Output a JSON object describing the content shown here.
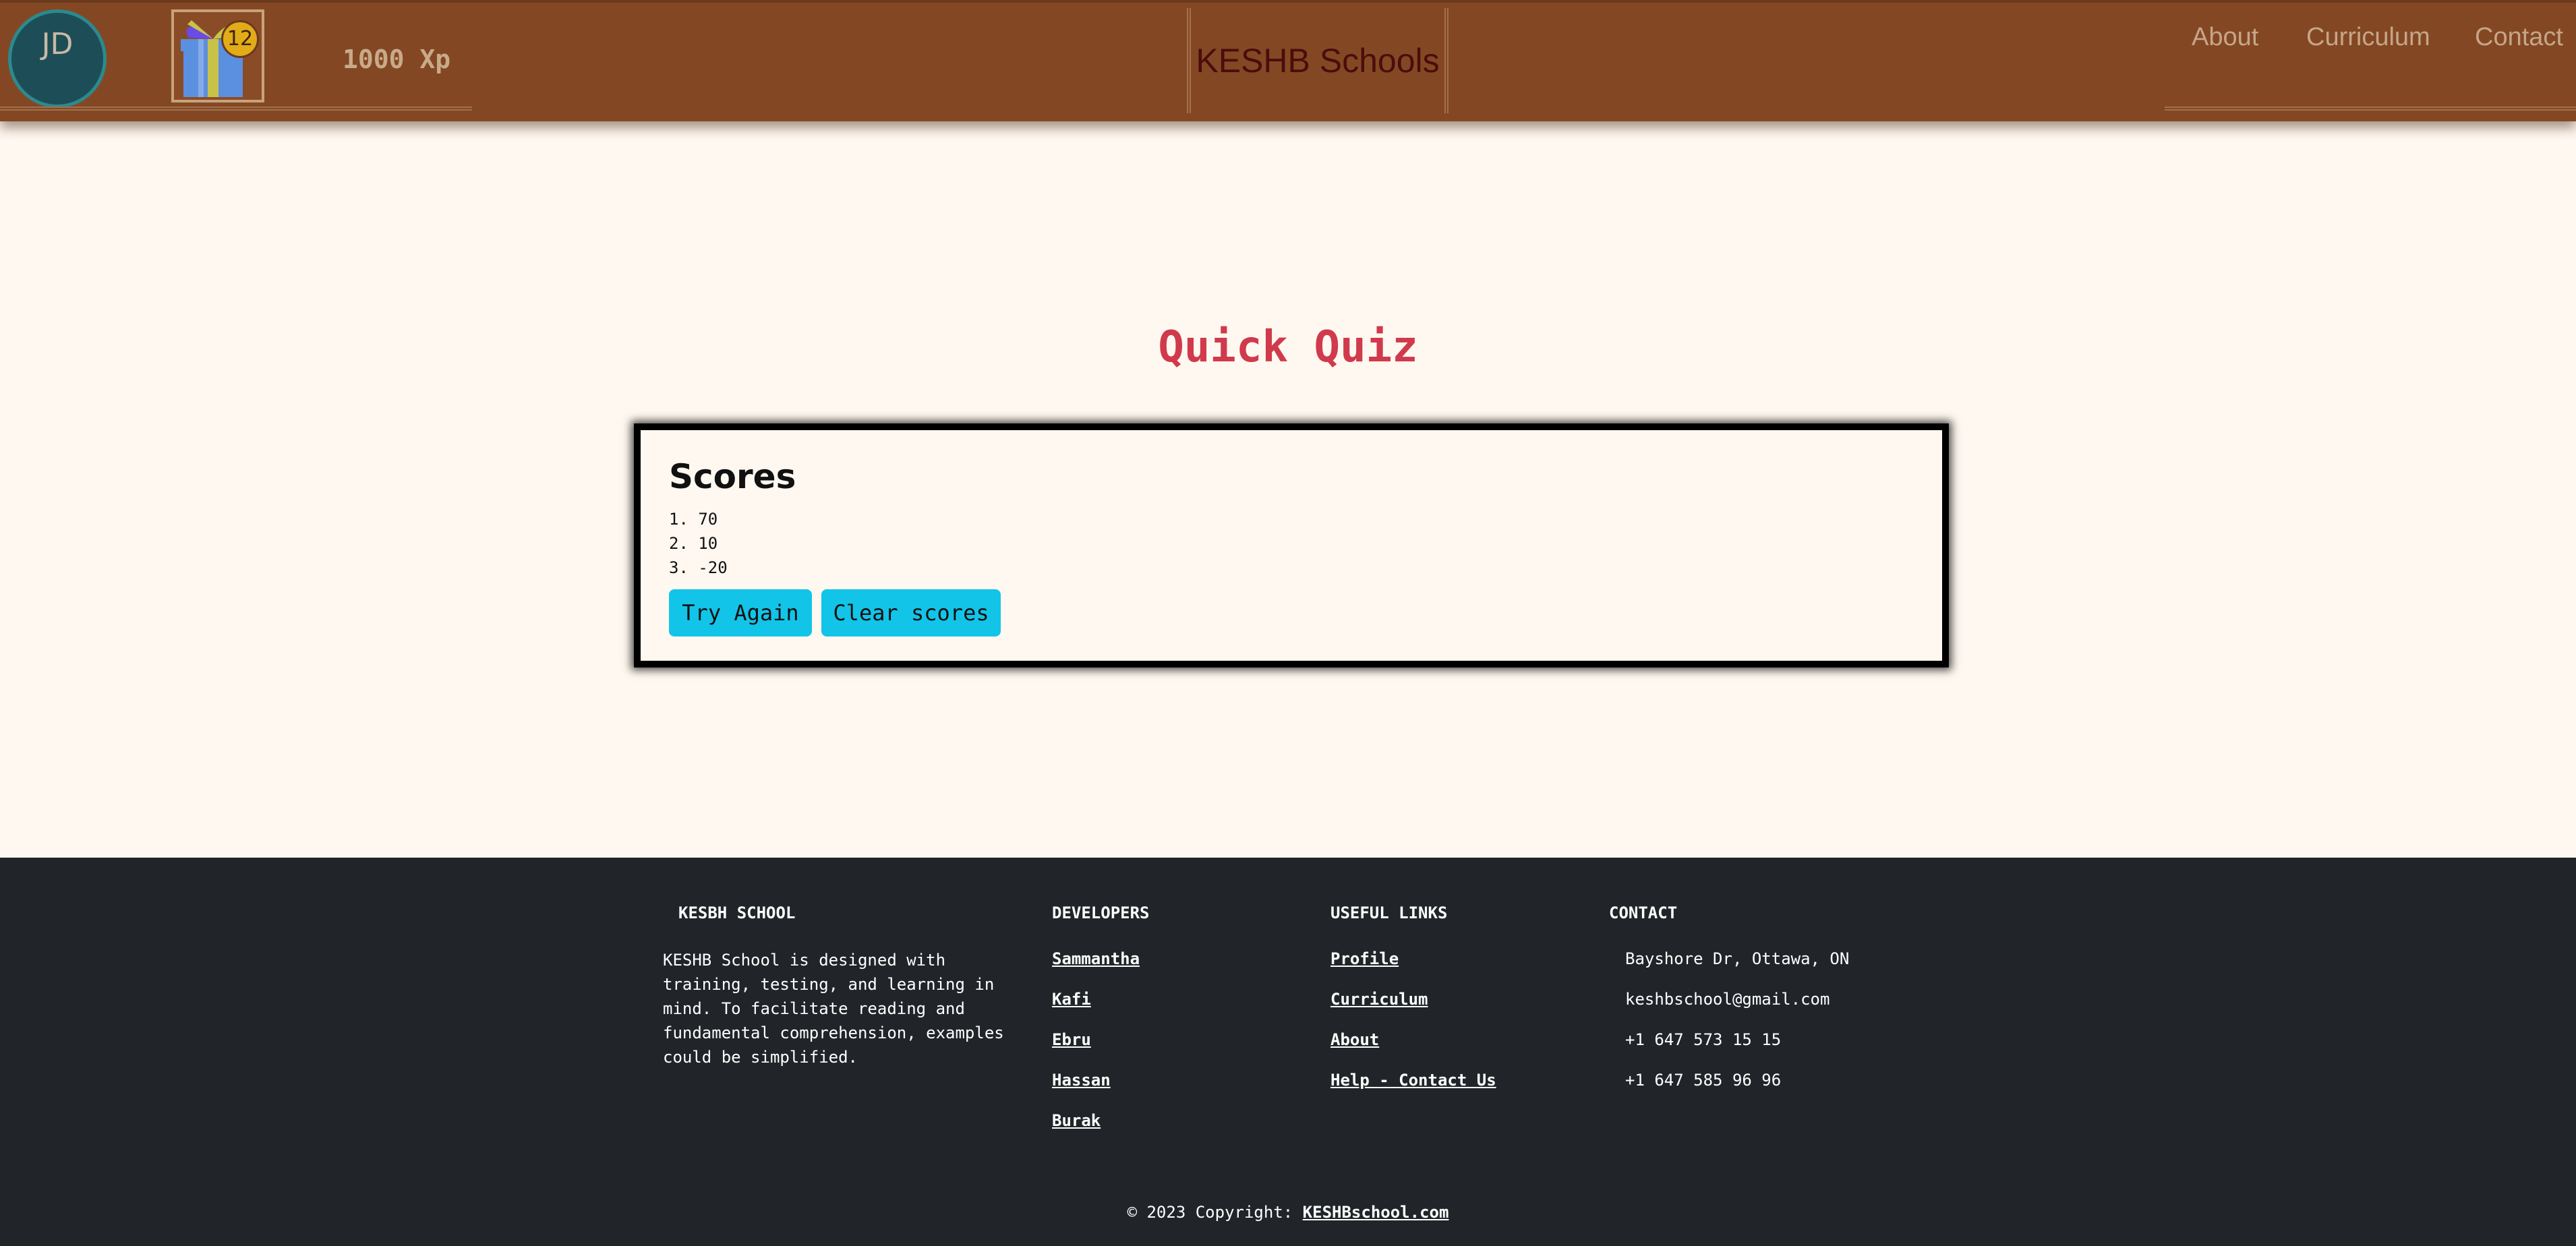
{
  "header": {
    "avatar_initials": "JD",
    "gift_badge_count": "12",
    "xp": "1000 Xp",
    "brand": "KESHB Schools",
    "nav": {
      "about": "About",
      "curriculum": "Curriculum",
      "contact": "Contact"
    }
  },
  "main": {
    "title": "Quick Quiz",
    "scores_heading": "Scores",
    "scores": [
      "1. 70",
      "2. 10",
      "3. -20"
    ],
    "try_again_label": "Try Again",
    "clear_scores_label": "Clear scores"
  },
  "footer": {
    "school_heading": "KESBH SCHOOL",
    "school_text": "KESHB School is designed with training, testing, and learning in mind. To facilitate reading and fundamental comprehension, examples could be simplified.",
    "developers_heading": "DEVELOPERS",
    "developers": [
      "Sammantha",
      "Kafi",
      "Ebru",
      "Hassan",
      "Burak"
    ],
    "links_heading": "USEFUL LINKS",
    "links": [
      "Profile",
      "Curriculum",
      "About",
      "Help - Contact Us"
    ],
    "contact_heading": "CONTACT",
    "contact": [
      "Bayshore Dr, Ottawa, ON",
      "keshbschool@gmail.com",
      "+1 647 573 15 15",
      "+1 647 585 96 96"
    ],
    "copyright_prefix": "© 2023 Copyright: ",
    "copyright_link": "KESHBschool.com"
  },
  "colors": {
    "header_bg": "#834823",
    "title_red": "#d03a4c",
    "button_cyan": "#12c4e8",
    "footer_bg": "#212529"
  },
  "icons": {
    "gift": "gift-icon"
  }
}
